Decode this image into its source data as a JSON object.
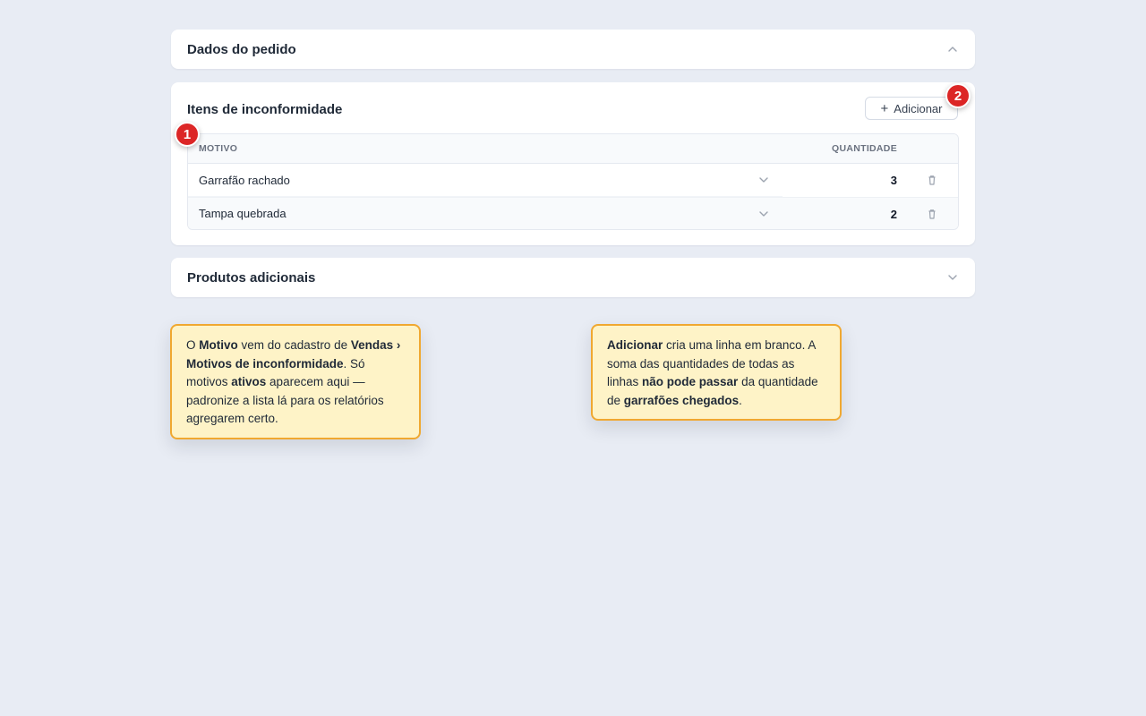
{
  "sections": {
    "pedido": {
      "title": "Dados do pedido",
      "icon": "chevron-up-icon"
    },
    "itens": {
      "title": "Itens de inconformidade",
      "add_button": {
        "label": "Adicionar",
        "icon": "plus-icon"
      },
      "table": {
        "columns": [
          "MOTIVO",
          "QUANTIDADE"
        ],
        "rows": [
          {
            "motivo": "Garrafão rachado",
            "quantidade": "3"
          },
          {
            "motivo": "Tampa quebrada",
            "quantidade": "2"
          }
        ]
      }
    },
    "produtos": {
      "title": "Produtos adicionais",
      "icon": "chevron-down-icon"
    }
  },
  "badges": [
    "1",
    "2"
  ],
  "notes": {
    "note1": {
      "t1": "O ",
      "b1": "Motivo",
      "t2": " vem do cadastro de ",
      "b2": "Vendas › Motivos de inconformidade",
      "t3": ". Só motivos ",
      "b3": "ativos",
      "t4": " aparecem aqui — padronize a lista lá para os relatórios agregarem certo."
    },
    "note2": {
      "b1": "Adicionar",
      "t1": " cria uma linha em branco. A soma das quantidades de todas as linhas ",
      "b2": "não pode passar",
      "t2": " da quantidade de ",
      "b3": "garrafões chegados",
      "t3": "."
    }
  },
  "colors": {
    "background": "#e8ecf4",
    "badge": "#dc2626",
    "note_bg": "#fef3c7",
    "note_border": "#f0a830"
  }
}
